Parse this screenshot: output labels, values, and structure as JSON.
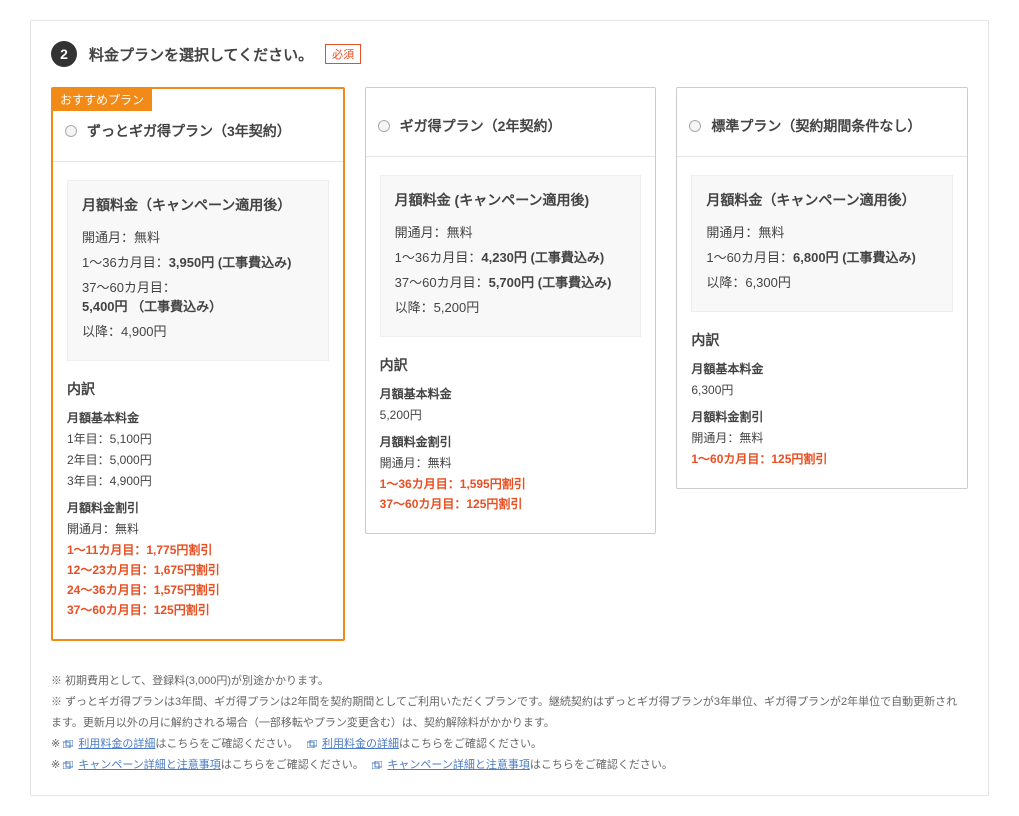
{
  "step": {
    "number": "2",
    "title": "料金プランを選択してください。",
    "required_label": "必須"
  },
  "plans": [
    {
      "recommend_label": "おすすめプラン",
      "name": "ずっとギガ得プラン（3年契約）",
      "price_title": "月額料金（キャンペーン適用後）",
      "price_lines": [
        {
          "label": "開通月：無料",
          "value": ""
        },
        {
          "label": "1～36カ月目：",
          "value": "3,950円 (工事費込み)"
        },
        {
          "label": "37～60カ月目：",
          "value": "5,400円 （工事費込み）"
        },
        {
          "label": "以降：4,900円",
          "value": ""
        }
      ],
      "breakdown_title": "内訳",
      "basic_title": "月額基本料金",
      "basic_lines": [
        "1年目：5,100円",
        "2年目：5,000円",
        "3年目：4,900円"
      ],
      "discount_title": "月額料金割引",
      "discount_free": "開通月：無料",
      "discount_lines": [
        "1～11カ月目：1,775円割引",
        "12～23カ月目：1,675円割引",
        "24～36カ月目：1,575円割引",
        "37～60カ月目：125円割引"
      ]
    },
    {
      "name": "ギガ得プラン（2年契約）",
      "price_title": "月額料金 (キャンペーン適用後)",
      "price_lines": [
        {
          "label": "開通月：無料",
          "value": ""
        },
        {
          "label": "1～36カ月目：",
          "value": "4,230円 (工事費込み)"
        },
        {
          "label": "37～60カ月目：",
          "value": "5,700円 (工事費込み)"
        },
        {
          "label": "以降：5,200円",
          "value": ""
        }
      ],
      "breakdown_title": "内訳",
      "basic_title": "月額基本料金",
      "basic_lines": [
        "5,200円"
      ],
      "discount_title": "月額料金割引",
      "discount_free": "開通月：無料",
      "discount_lines": [
        "1～36カ月目：1,595円割引",
        "37～60カ月目：125円割引"
      ]
    },
    {
      "name": "標準プラン（契約期間条件なし）",
      "price_title": "月額料金（キャンペーン適用後）",
      "price_lines": [
        {
          "label": "開通月：無料",
          "value": ""
        },
        {
          "label": "1～60カ月目：",
          "value": "6,800円 (工事費込み)"
        },
        {
          "label": "以降：6,300円",
          "value": ""
        }
      ],
      "breakdown_title": "内訳",
      "basic_title": "月額基本料金",
      "basic_lines": [
        "6,300円"
      ],
      "discount_title": "月額料金割引",
      "discount_free": "開通月：無料",
      "discount_lines": [
        "1～60カ月目：125円割引"
      ]
    }
  ],
  "notes": {
    "n1_prefix": "※ ",
    "n1": "初期費用として、登録料(3,000円)が別途かかります。",
    "n2_prefix": "※ ",
    "n2": "ずっとギガ得プランは3年間、ギガ得プランは2年間を契約期間としてご利用いただくプランです。継続契約はずっとギガ得プランが3年単位、ギガ得プランが2年単位で自動更新されます。更新月以外の月に解約される場合（一部移転やプラン変更含む）は、契約解除料がかかります。",
    "n3_prefix": "※ ",
    "n3_link1": "利用料金の詳細",
    "n3_mid1": "はこちらをご確認ください。　",
    "n3_link2": "利用料金の詳細",
    "n3_mid2": "はこちらをご確認ください。",
    "n4_prefix": "※ ",
    "n4_link1": "キャンペーン詳細と注意事項",
    "n4_mid1": "はこちらをご確認ください。　",
    "n4_link2": "キャンペーン詳細と注意事項",
    "n4_mid2": "はこちらをご確認ください。"
  }
}
